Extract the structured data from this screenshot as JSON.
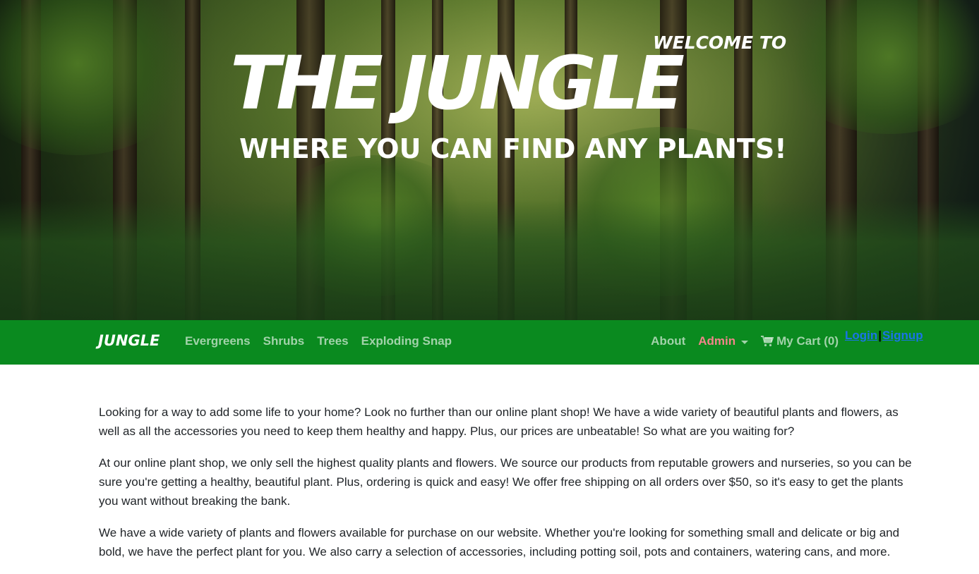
{
  "hero": {
    "welcome": "WELCOME TO",
    "title": "THE JUNGLE",
    "subtitle": "WHERE YOU CAN FIND ANY PLANTS!"
  },
  "navbar": {
    "brand": "JUNGLE",
    "links": [
      "Evergreens",
      "Shrubs",
      "Trees",
      "Exploding Snap"
    ],
    "about": "About",
    "admin": "Admin",
    "cart": "My Cart (0)",
    "login": "Login",
    "separator": "|",
    "signup": "Signup",
    "background_color": "#0a8a1f",
    "admin_color": "#f2858a",
    "auth_link_color": "#1a74e8",
    "cart_icon": "shopping-cart-icon"
  },
  "content": {
    "paragraphs": [
      "Looking for a way to add some life to your home? Look no further than our online plant shop! We have a wide variety of beautiful plants and flowers, as well as all the accessories you need to keep them healthy and happy. Plus, our prices are unbeatable! So what are you waiting for?",
      "At our online plant shop, we only sell the highest quality plants and flowers. We source our products from reputable growers and nurseries, so you can be sure you're getting a healthy, beautiful plant. Plus, ordering is quick and easy! We offer free shipping on all orders over $50, so it's easy to get the plants you want without breaking the bank.",
      "We have a wide variety of plants and flowers available for purchase on our website. Whether you're looking for something small and delicate or big and bold, we have the perfect plant for you. We also carry a selection of accessories, including potting soil, pots and containers, watering cans, and more."
    ]
  }
}
